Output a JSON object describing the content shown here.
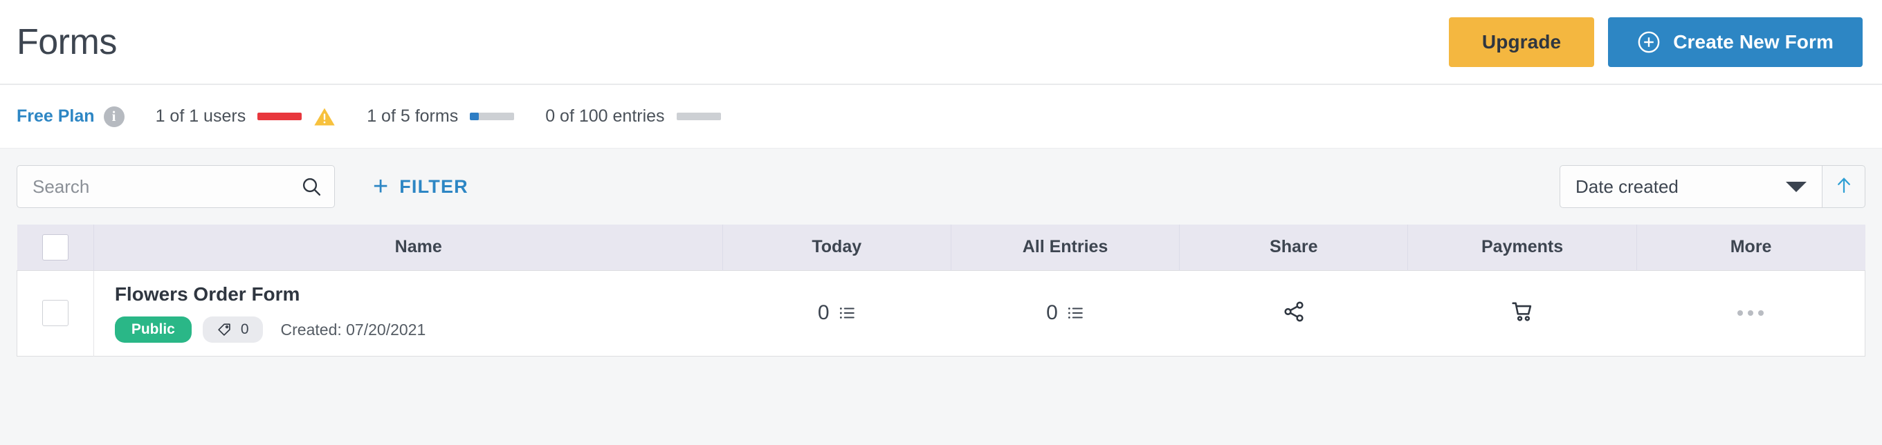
{
  "header": {
    "title": "Forms",
    "upgrade_label": "Upgrade",
    "create_label": "Create New Form"
  },
  "plan_bar": {
    "plan_label": "Free Plan",
    "info_glyph": "i",
    "usage": [
      {
        "text": "1 of 1 users",
        "percent": 100,
        "color": "#e8373d",
        "warning": true
      },
      {
        "text": "1 of 5 forms",
        "percent": 20,
        "color": "#2d7dc4",
        "warning": false
      },
      {
        "text": "0 of 100 entries",
        "percent": 0,
        "color": "#cdd0d4",
        "warning": false
      }
    ]
  },
  "toolbar": {
    "search_placeholder": "Search",
    "search_value": "",
    "filter_label": "FILTER",
    "filter_plus": "+",
    "sort_value": "Date created",
    "sort_direction": "ascending"
  },
  "table": {
    "columns": [
      {
        "key": "check",
        "label": ""
      },
      {
        "key": "name",
        "label": "Name"
      },
      {
        "key": "today",
        "label": "Today"
      },
      {
        "key": "all",
        "label": "All Entries"
      },
      {
        "key": "share",
        "label": "Share"
      },
      {
        "key": "payments",
        "label": "Payments"
      },
      {
        "key": "more",
        "label": "More"
      }
    ],
    "rows": [
      {
        "name": "Flowers Order Form",
        "status_badge": "Public",
        "tag_count": "0",
        "created": "Created: 07/20/2021",
        "today": "0",
        "all_entries": "0",
        "share_icon": "share-nodes-icon",
        "payments_icon": "shopping-cart-icon",
        "more_icon": "ellipsis-icon"
      }
    ]
  },
  "colors": {
    "accent_blue": "#2d86c4",
    "upgrade_yellow": "#f4b740",
    "public_green": "#2ab787",
    "header_row": "#e8e7f0",
    "page_bg": "#f5f6f7"
  }
}
